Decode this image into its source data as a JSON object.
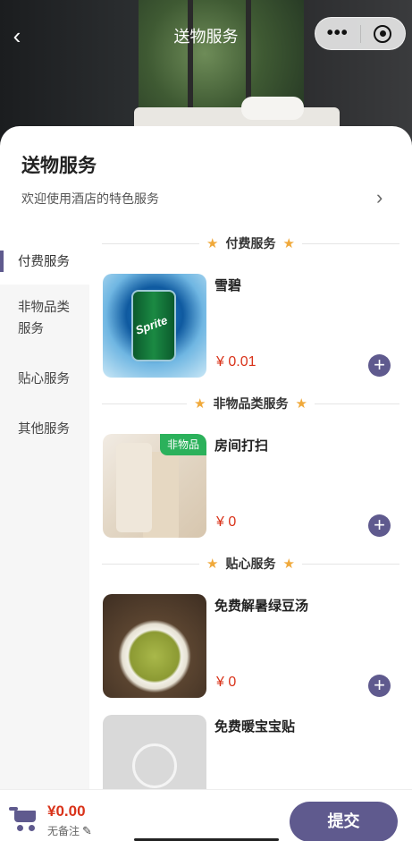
{
  "nav": {
    "title": "送物服务",
    "back_icon": "back-chevron-icon",
    "more_glyph": "•••"
  },
  "header": {
    "title": "送物服务",
    "subtitle": "欢迎使用酒店的特色服务"
  },
  "sidebar": {
    "items": [
      {
        "label": "付费服务",
        "active": true
      },
      {
        "label": "非物品类服务",
        "active": false
      },
      {
        "label": "贴心服务",
        "active": false
      },
      {
        "label": "其他服务",
        "active": false
      }
    ]
  },
  "sections": [
    {
      "title": "付费服务"
    },
    {
      "title": "非物品类服务"
    },
    {
      "title": "贴心服务"
    }
  ],
  "products": [
    {
      "name": "雪碧",
      "price": "¥ 0.01",
      "image": "sprite-can",
      "tag": ""
    },
    {
      "name": "房间打扫",
      "price": "¥ 0",
      "image": "towel",
      "tag": "非物品"
    },
    {
      "name": "免费解暑绿豆汤",
      "price": "¥ 0",
      "image": "mung-bean-soup",
      "tag": ""
    },
    {
      "name": "免费暖宝宝贴",
      "price": "",
      "image": "placeholder",
      "tag": ""
    }
  ],
  "cart": {
    "total": "¥0.00",
    "remark": "无备注",
    "submit": "提交"
  },
  "colors": {
    "accent": "#5f5a8e",
    "price": "#d9331a",
    "star": "#f0a93b",
    "tag": "#2bb15b"
  }
}
